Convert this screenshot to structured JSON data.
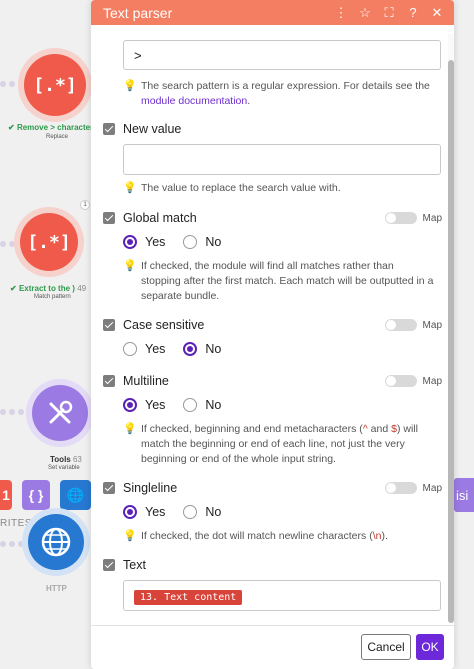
{
  "canvas": {
    "modules": [
      {
        "glyph": "[.*]",
        "label": "Remove > character",
        "sub": "Replace"
      },
      {
        "glyph": "[.*]",
        "label": "Extract to the )",
        "badge": "49",
        "sub": "Match pattern"
      },
      {
        "label": "Tools",
        "badge": "63",
        "sub": "Set variable"
      },
      {
        "label": "HTTP"
      }
    ],
    "tiles": [
      "1",
      "{ }"
    ],
    "favorites_label": "RITES",
    "right_tile_label": "isi"
  },
  "dialog": {
    "title": "Text parser",
    "header_icons": [
      "more-icon",
      "star-icon",
      "expand-icon",
      "help-icon",
      "close-icon"
    ],
    "pattern_value": ">",
    "pattern_hint": "The search pattern is a regular expression. For details see the",
    "pattern_hint_link": "module documentation",
    "pattern_hint_end": ".",
    "new_value": {
      "label": "New value",
      "value": "",
      "hint": "The value to replace the search value with."
    },
    "global_match": {
      "label": "Global match",
      "map": "Map",
      "yes": "Yes",
      "no": "No",
      "selected": "Yes",
      "hint": "If checked, the module will find all matches rather than stopping after the first match. Each match will be outputted in a separate bundle."
    },
    "case_sensitive": {
      "label": "Case sensitive",
      "map": "Map",
      "yes": "Yes",
      "no": "No",
      "selected": "No"
    },
    "multiline": {
      "label": "Multiline",
      "map": "Map",
      "yes": "Yes",
      "no": "No",
      "selected": "Yes",
      "hint_a": "If checked, beginning and end metacharacters (",
      "hint_code1": "^",
      "hint_b": " and ",
      "hint_code2": "$",
      "hint_c": ") will match the beginning or end of each line, not just the very beginning or end of the whole input string."
    },
    "singleline": {
      "label": "Singleline",
      "map": "Map",
      "yes": "Yes",
      "no": "No",
      "selected": "Yes",
      "hint_a": "If checked, the dot will match newline characters (",
      "hint_code": "\\n",
      "hint_b": ")."
    },
    "text": {
      "label": "Text",
      "pill": "13. Text content"
    },
    "buttons": {
      "cancel": "Cancel",
      "ok": "OK"
    }
  },
  "colors": {
    "header": "#f47e62",
    "accent": "#6d28d9",
    "pill": "#d9443a"
  }
}
